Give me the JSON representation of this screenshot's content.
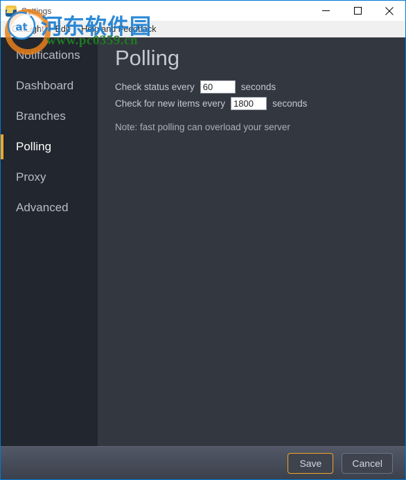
{
  "window": {
    "title": "Settings",
    "icon": "app-folder-icon",
    "controls": {
      "minimize": "minimize-icon",
      "maximize": "maximize-icon",
      "close": "close-icon"
    }
  },
  "menubar": {
    "items": [
      {
        "label": "CatLight"
      },
      {
        "label": "Edit"
      },
      {
        "label": "Help and Feedback"
      }
    ]
  },
  "sidebar": {
    "items": [
      {
        "label": "Notifications",
        "active": false
      },
      {
        "label": "Dashboard",
        "active": false
      },
      {
        "label": "Branches",
        "active": false
      },
      {
        "label": "Polling",
        "active": true
      },
      {
        "label": "Proxy",
        "active": false
      },
      {
        "label": "Advanced",
        "active": false
      }
    ],
    "active_indicator_color": "#f5a623"
  },
  "main": {
    "title": "Polling",
    "fields": [
      {
        "label_before": "Check status every",
        "value": "60",
        "label_after": "seconds"
      },
      {
        "label_before": "Check for new items every",
        "value": "1800",
        "label_after": "seconds"
      }
    ],
    "note": "Note: fast polling can overload your server"
  },
  "footer": {
    "save_label": "Save",
    "cancel_label": "Cancel",
    "save_border_color": "#f5a623"
  },
  "watermark": {
    "chinese_text": "河东软件园",
    "url_text": "www.pc0359.cn",
    "chinese_color": "#1a7fd4",
    "url_color": "#1f7a24"
  }
}
